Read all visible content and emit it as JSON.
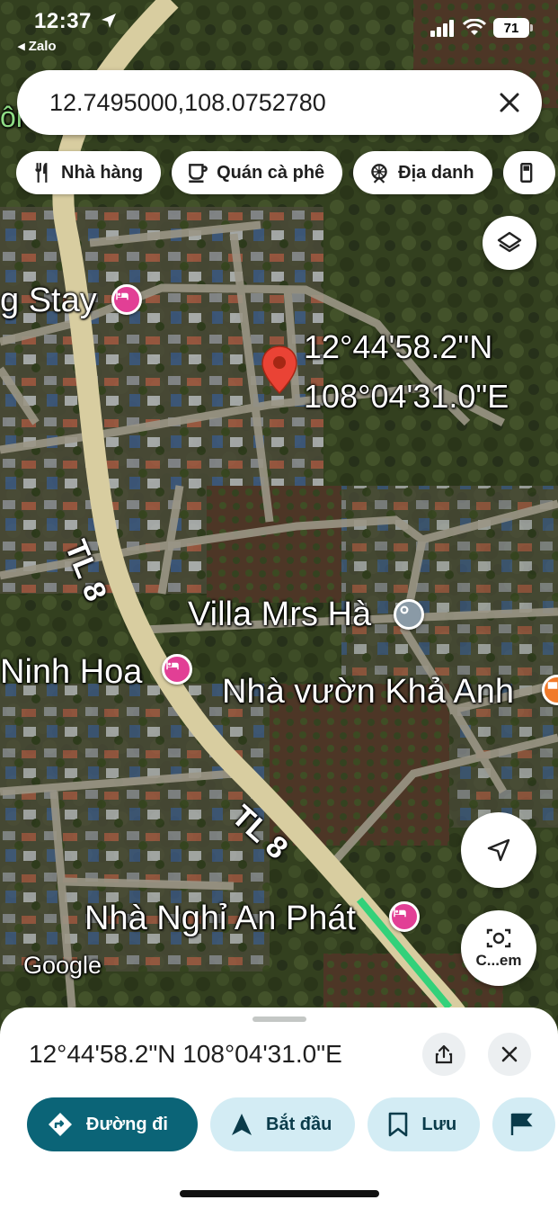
{
  "status": {
    "time": "12:37",
    "back_app": "◂ Zalo",
    "battery": "71"
  },
  "search": {
    "value": "12.7495000,108.0752780"
  },
  "chips": [
    {
      "label": "Nhà hàng",
      "icon": "restaurant-icon"
    },
    {
      "label": "Quán cà phê",
      "icon": "coffee-icon"
    },
    {
      "label": "Địa danh",
      "icon": "attraction-icon"
    },
    {
      "label": "",
      "icon": "gas-station-icon"
    }
  ],
  "map": {
    "pin_lat": "12°44'58.2\"N",
    "pin_lng": "108°04'31.0\"E",
    "labels": {
      "stay": "g Stay",
      "villa": "Villa Mrs Hà",
      "ninh_hoa": "Ninh Hoa",
      "nha_vuon": "Nhà vườn Khả Anh",
      "an_phat": "Nhà Nghỉ An Phát",
      "road_1": "TL 8",
      "road_2": "TL 8",
      "google": "Google",
      "edge": "ôn"
    },
    "camera_label": "C...em"
  },
  "sheet": {
    "title": "12°44'58.2\"N 108°04'31.0\"E",
    "actions": [
      {
        "label": "Đường đi"
      },
      {
        "label": "Bắt đầu"
      },
      {
        "label": "Lưu"
      }
    ]
  },
  "colors": {
    "accent": "#0b6477",
    "secondary_btn": "#d3ecf4",
    "pin_red": "#ea4335",
    "hotel_pink": "#e23f95"
  }
}
